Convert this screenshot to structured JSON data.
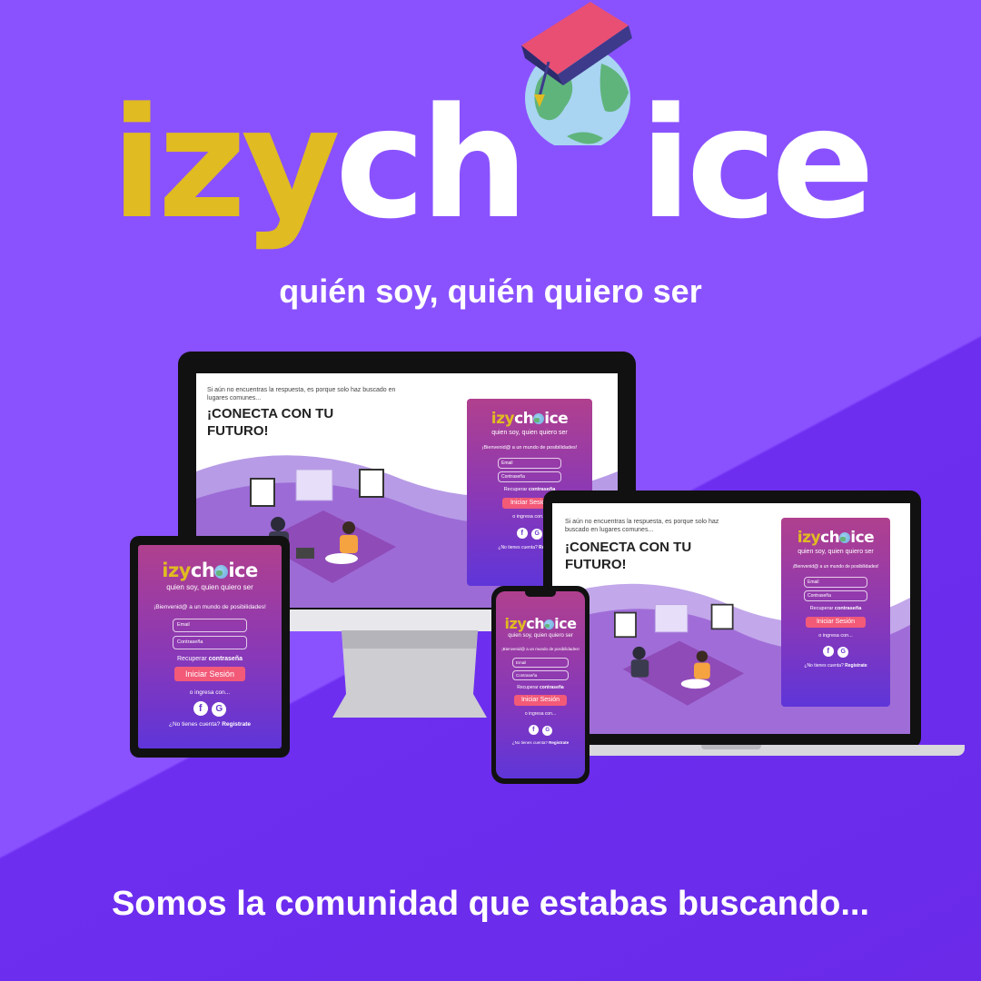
{
  "brand": {
    "name_part1": "izy",
    "name_part2": "ch",
    "name_part3": "ice",
    "tagline": "quién soy, quién quiero ser",
    "slogan": "Somos la comunidad que estabas buscando...",
    "colors": {
      "yellow": "#e0bb21",
      "background": "#8a52ff",
      "button": "#f25a78"
    }
  },
  "website": {
    "intro": "Si aún no encuentras la respuesta, es porque solo haz buscado en lugares comunes...",
    "headline_line1": "¡CONECTA CON TU",
    "headline_line2": "FUTURO!",
    "login": {
      "logo_part1": "izy",
      "logo_part2": "ch",
      "logo_part3": "ice",
      "subtitle": "quien soy, quien quiero ser",
      "welcome": "¡Bienvenid@ a un mundo de posibilidades!",
      "email_placeholder": "Email",
      "password_placeholder": "Contraseña",
      "recover_prefix": "Recuperar",
      "recover_link": "contraseña",
      "login_button": "Iniciar Sesión",
      "alt_login": "o ingresa con...",
      "facebook_icon": "f",
      "google_icon": "G",
      "signup_prefix": "¿No tienes cuenta?",
      "signup_link": "Registrate"
    }
  },
  "devices": [
    "desktop-monitor",
    "laptop",
    "tablet",
    "phone"
  ]
}
